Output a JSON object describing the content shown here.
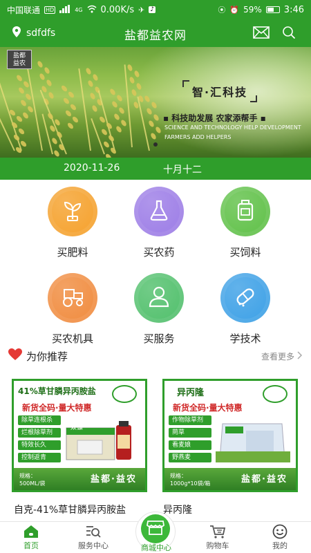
{
  "status_bar": {
    "carrier": "中国联通",
    "hd": "HD",
    "network": "4G",
    "speed": "0.00K/s",
    "battery": "59%",
    "battery_level": 0.59,
    "time": "3:46"
  },
  "header": {
    "location": "sdfdfs",
    "title": "盐都益农网"
  },
  "banner": {
    "logo_line1": "盐都",
    "logo_line2": "益农",
    "slogan_main": "智·汇科技",
    "slogan_sub": "▪ 科技助发展  农家添帮手 ▪",
    "slogan_en1": "SCIENCE AND TECHNOLOGY HELP DEVELOPMENT",
    "slogan_en2": "FARMERS ADD HELPERS"
  },
  "date_bar": {
    "date": "2020-11-26",
    "lunar": "十月十二"
  },
  "categories": [
    {
      "label": "买肥料",
      "color": "#f5a02a",
      "icon": "sprout-icon"
    },
    {
      "label": "买农药",
      "color": "#9b7be6",
      "icon": "flask-icon"
    },
    {
      "label": "买饲料",
      "color": "#5ec046",
      "icon": "feed-bottle-icon"
    },
    {
      "label": "买农机具",
      "color": "#f08a3c",
      "icon": "tractor-icon"
    },
    {
      "label": "买服务",
      "color": "#4fbf6a",
      "icon": "person-service-icon"
    },
    {
      "label": "学技术",
      "color": "#3a9fe6",
      "icon": "capsule-icon"
    }
  ],
  "recommend": {
    "title": "为你推荐",
    "more": "查看更多"
  },
  "products": [
    {
      "card_title": "41%草甘膦异丙胺盐",
      "promo": "新货全码·量大特惠",
      "features": [
        "除草连根杀",
        "烂根除草剂",
        "特效长久",
        "控制返青"
      ],
      "box_label": "双镰",
      "spec_label": "规格：",
      "spec": "500ML/袋",
      "brand": "盐都·益农",
      "name": "自克-41%草甘膦异丙胺盐"
    },
    {
      "card_title": "异丙隆",
      "promo": "新货全码·量大特惠",
      "features": [
        "作物除草剂",
        "菵草",
        "看麦娘",
        "野燕麦"
      ],
      "box_label": "",
      "spec_label": "规格：",
      "spec": "1000g*10袋/箱",
      "brand": "盐都·益农",
      "name": "异丙隆"
    }
  ],
  "nav": {
    "home": "首页",
    "service": "服务中心",
    "mall": "商城中心",
    "cart": "购物车",
    "mine": "我的"
  },
  "colors": {
    "primary": "#2f9e2b",
    "promo_red": "#d02a2a"
  }
}
